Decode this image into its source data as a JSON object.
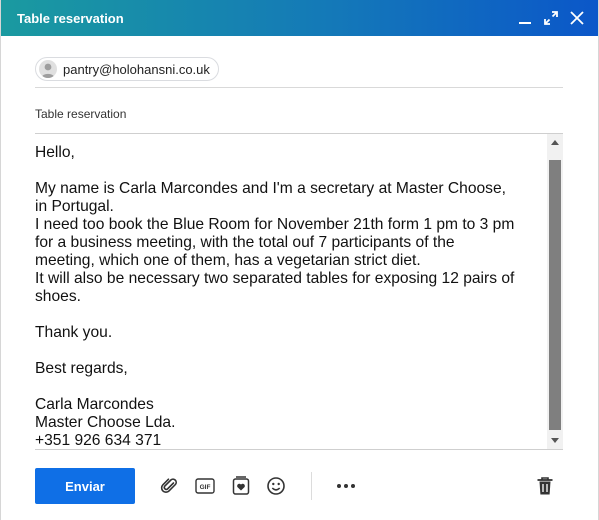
{
  "window": {
    "title": "Table reservation",
    "controls": [
      "minimize-icon",
      "expand-icon",
      "close-icon"
    ]
  },
  "recipients": [
    {
      "email": "pantry@holohansni.co.uk"
    }
  ],
  "subject": "Table reservation",
  "body": "Hello,\n\nMy name is Carla Marcondes and I'm a secretary at Master Choose,\nin Portugal.\nI need too book the Blue Room for November 21th form 1 pm to 3 pm\nfor a business meeting, with the total ouf 7 participants of the\nmeeting, which one of them, has a vegetarian strict diet.\nIt will also be necessary two separated tables for exposing 12 pairs of\nshoes.\n\nThank you.\n\nBest regards,\n\nCarla Marcondes\nMaster Choose Lda.\n+351 926 634 371",
  "toolbar": {
    "send_label": "Enviar",
    "gif_label": "GIF",
    "icons": [
      "attach-icon",
      "gif-icon",
      "sticker-icon",
      "emoji-icon",
      "more-icon",
      "delete-icon"
    ]
  },
  "colors": {
    "title_gradient_start": "#1a9aa0",
    "title_gradient_end": "#0b57c9",
    "send_button": "#0f6fe6"
  }
}
